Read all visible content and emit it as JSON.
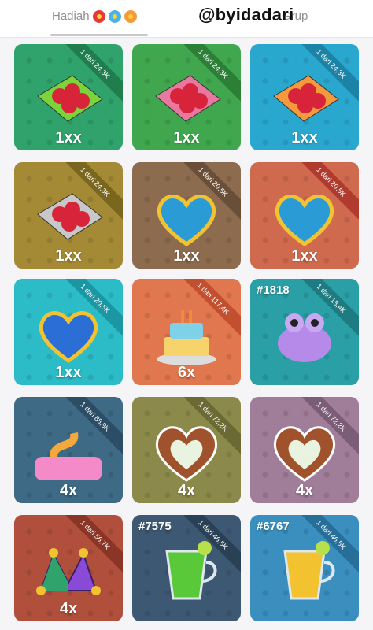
{
  "tabs": {
    "hadiah_label": "Hadiah",
    "grup_label": "Grup",
    "hadiah_icons": [
      "red-flower-icon",
      "blue-flower-icon",
      "orange-flower-icon"
    ]
  },
  "watermark": "@byidadari",
  "colors": {
    "red_flower": "#e63a3a",
    "blue_flower": "#4ab3e8",
    "orange_flower": "#f59a3c"
  },
  "gifts": [
    {
      "name": "strawberry-box-green",
      "icon": "chocolate-strawberry-box-icon",
      "ribbon": "1 dari 24,3K",
      "qty": "1xx",
      "number": "",
      "bg": "#2fa36b",
      "ribbon_color": "#1f7d4e"
    },
    {
      "name": "strawberry-box-pixel",
      "icon": "pixelated-candy-box-icon",
      "ribbon": "1 dari 24,3K",
      "qty": "1xx",
      "number": "",
      "bg": "#41a74e",
      "ribbon_color": "#2b7f36"
    },
    {
      "name": "strawberry-box-blue",
      "icon": "blue-strawberry-box-icon",
      "ribbon": "1 dari 24,3K",
      "qty": "1xx",
      "number": "",
      "bg": "#2aa7cf",
      "ribbon_color": "#1c83a6"
    },
    {
      "name": "strawberry-box-letters",
      "icon": "letter-strawberry-box-icon",
      "ribbon": "1 dari 24,3K",
      "qty": "1xx",
      "number": "",
      "bg": "#a48a34",
      "ribbon_color": "#7a661f"
    },
    {
      "name": "heart-web-brown",
      "icon": "stitched-heart-icon",
      "ribbon": "1 dari 20,5K",
      "qty": "1xx",
      "number": "",
      "bg": "#8c6b4e",
      "ribbon_color": "#6a4f38"
    },
    {
      "name": "heart-web-red",
      "icon": "stitched-heart-icon",
      "ribbon": "1 dari 20,5K",
      "qty": "1xx",
      "number": "",
      "bg": "#d06a4e",
      "ribbon_color": "#b03a2e"
    },
    {
      "name": "heart-web-teal",
      "icon": "blue-stitched-heart-icon",
      "ribbon": "1 dari 20,5K",
      "qty": "1xx",
      "number": "",
      "bg": "#2bbcc8",
      "ribbon_color": "#1b97a3"
    },
    {
      "name": "birthday-cake",
      "icon": "birthday-cake-icon",
      "ribbon": "1 dari 117,4K",
      "qty": "6x",
      "number": "",
      "bg": "#e0774e",
      "ribbon_color": "#c24f2f"
    },
    {
      "name": "frog",
      "icon": "frog-icon",
      "ribbon": "1 dari 13,4K",
      "qty": "",
      "number": "#1818",
      "bg": "#2a9fa6",
      "ribbon_color": "#1d7b81"
    },
    {
      "name": "2025-snake",
      "icon": "snake-2025-icon",
      "ribbon": "1 dari 88,9K",
      "qty": "4x",
      "number": "",
      "bg": "#3e6a86",
      "ribbon_color": "#2b4e66"
    },
    {
      "name": "gingerbread-heart-green",
      "icon": "cookie-heart-icon",
      "ribbon": "1 dari 72,2K",
      "qty": "4x",
      "number": "",
      "bg": "#8c8a4a",
      "ribbon_color": "#6b6a34"
    },
    {
      "name": "gingerbread-heart-white",
      "icon": "cookie-heart-icon",
      "ribbon": "1 dari 72,2K",
      "qty": "4x",
      "number": "",
      "bg": "#a07d98",
      "ribbon_color": "#7c5d76"
    },
    {
      "name": "jester-hat",
      "icon": "jester-hat-icon",
      "ribbon": "1 dari 56,7K",
      "qty": "4x",
      "number": "",
      "bg": "#b0503c",
      "ribbon_color": "#8a3526"
    },
    {
      "name": "green-drink",
      "icon": "green-drink-mug-icon",
      "ribbon": "1 dari 46,5K",
      "qty": "",
      "number": "#7575",
      "bg": "#3d5873",
      "ribbon_color": "#2a4055"
    },
    {
      "name": "yellow-drink",
      "icon": "yellow-drink-mug-icon",
      "ribbon": "1 dari 46,5K",
      "qty": "",
      "number": "#6767",
      "bg": "#3a8fbf",
      "ribbon_color": "#276f99"
    }
  ]
}
